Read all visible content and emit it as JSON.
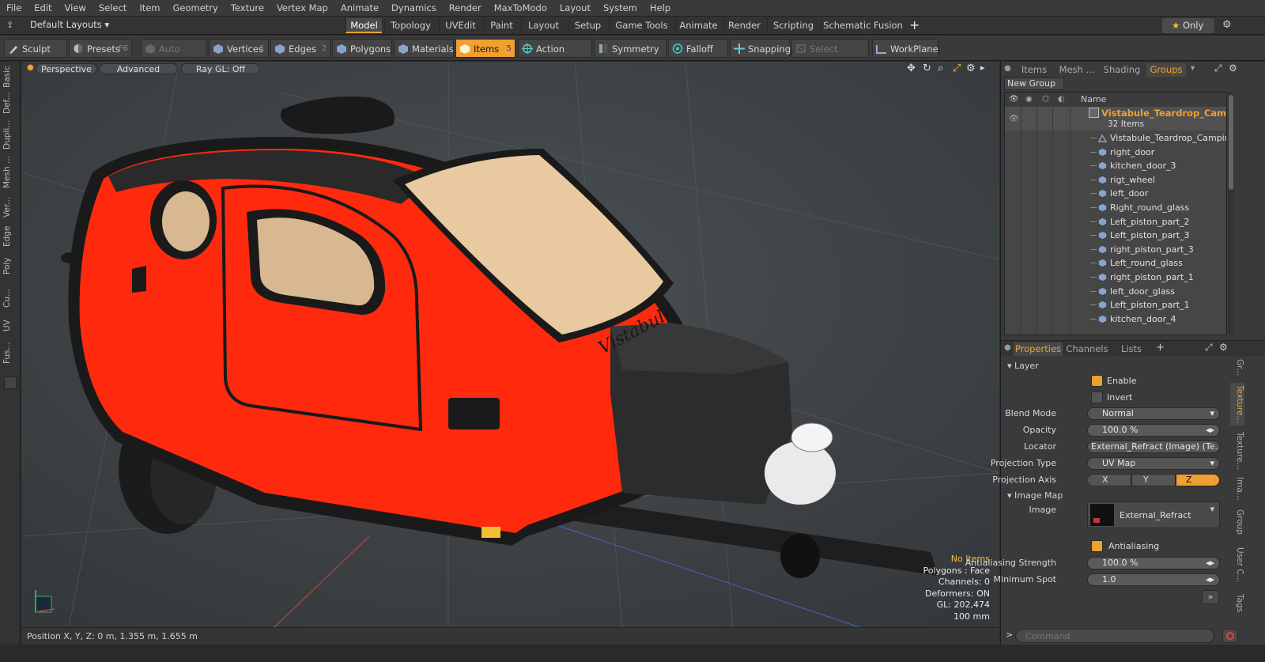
{
  "menu": [
    "File",
    "Edit",
    "View",
    "Select",
    "Item",
    "Geometry",
    "Texture",
    "Vertex Map",
    "Animate",
    "Dynamics",
    "Render",
    "MaxToModo",
    "Layout",
    "System",
    "Help"
  ],
  "layout": {
    "selector": "Default Layouts",
    "tabs": [
      "Model",
      "Topology",
      "UVEdit",
      "Paint",
      "Layout",
      "Setup",
      "Game Tools",
      "Animate",
      "Render",
      "Scripting",
      "Schematic Fusion"
    ],
    "only_label": "Only"
  },
  "toolbar": {
    "sculpt": "Sculpt",
    "presets": "Presets",
    "presets_key": "F6",
    "auto_select": "Auto Select",
    "vertices": "Vertices",
    "vertices_count": "1",
    "edges": "Edges",
    "edges_count": "2",
    "polygons": "Polygons",
    "materials": "Materials",
    "items": "Items",
    "items_count": "5",
    "action_center": "Action Center",
    "symmetry": "Symmetry",
    "falloff": "Falloff",
    "snapping": "Snapping",
    "select_through": "Select Through",
    "workplane": "WorkPlane"
  },
  "left_tabs": [
    "Basic",
    "Def...",
    "Dupli...",
    "Mesh ...",
    "Ver...",
    "Edge",
    "Poly",
    "Cu...",
    "UV",
    "Fus..."
  ],
  "viewport": {
    "view_mode": "Perspective",
    "shading": "Advanced",
    "raygl": "Ray GL: Off",
    "hud": {
      "items": "No Items",
      "polygons": "Polygons : Face",
      "channels": "Channels: 0",
      "deformers": "Deformers: ON",
      "gl": "GL: 202,474",
      "scale": "100 mm"
    },
    "decal_text": "Vistabule"
  },
  "status": {
    "position": "Position X, Y, Z:   0 m, 1.355 m, 1.655 m"
  },
  "right_panel": {
    "tabs": [
      "Items",
      "Mesh ...",
      "Shading",
      "Groups"
    ],
    "new_group": "New Group",
    "name_header": "Name",
    "group_name": "Vistabule_Teardrop_Cam ...",
    "group_count": "32 Items",
    "items": [
      "Vistabule_Teardrop_Campin ...",
      "right_door",
      "kitchen_door_3",
      "rigt_wheel",
      "left_door",
      "Right_round_glass",
      "Left_piston_part_2",
      "Left_piston_part_3",
      "right_piston_part_3",
      "Left_round_glass",
      "right_piston_part_1",
      "left_door_glass",
      "Left_piston_part_1",
      "kitchen_door_4"
    ],
    "prop_tabs": [
      "Properties",
      "Channels",
      "Lists"
    ],
    "side_tabs": [
      "Gr...",
      "Texture...",
      "Texture...",
      "Ima...",
      "Group",
      "User C...",
      "Tags"
    ],
    "layer": {
      "section": "Layer",
      "enable": "Enable",
      "invert": "Invert",
      "blend_mode_label": "Blend Mode",
      "blend_mode": "Normal",
      "opacity_label": "Opacity",
      "opacity": "100.0 %",
      "locator_label": "Locator",
      "locator": "External_Refract (Image) (Te...",
      "projection_type_label": "Projection Type",
      "projection_type": "UV Map",
      "projection_axis_label": "Projection Axis",
      "axes": [
        "X",
        "Y",
        "Z"
      ],
      "active_axis": "Z"
    },
    "image_map": {
      "section": "Image Map",
      "image_label": "Image",
      "image": "External_Refract",
      "antialiasing": "Antialiasing",
      "aa_strength_label": "Antialiasing Strength",
      "aa_strength": "100.0 %",
      "min_spot_label": "Minimum Spot",
      "min_spot": "1.0"
    },
    "command_placeholder": "Command"
  },
  "colors": {
    "accent": "#f0a030",
    "trailer": "#ff2a0e"
  }
}
